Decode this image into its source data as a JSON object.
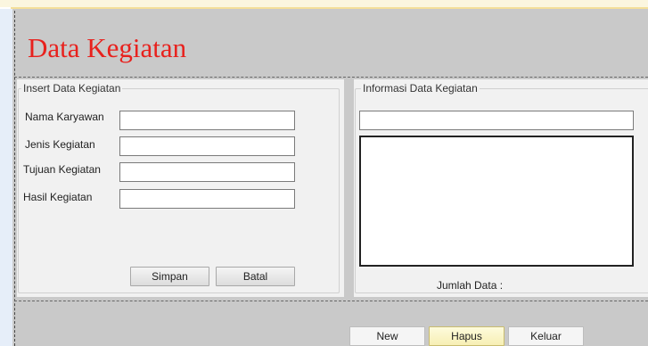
{
  "form": {
    "title": "Data Kegiatan"
  },
  "insert": {
    "legend": "Insert Data Kegiatan",
    "fields": [
      {
        "label": "Nama Karyawan",
        "value": ""
      },
      {
        "label": "Jenis Kegiatan",
        "value": ""
      },
      {
        "label": "Tujuan Kegiatan",
        "value": ""
      },
      {
        "label": "Hasil Kegiatan",
        "value": ""
      }
    ],
    "buttons": {
      "save": "Simpan",
      "cancel": "Batal"
    }
  },
  "info": {
    "legend": "Informasi Data Kegiatan",
    "search_value": "",
    "count_label": "Jumlah Data :"
  },
  "footer": {
    "buttons": {
      "new": "New",
      "delete": "Hapus",
      "exit": "Keluar"
    }
  }
}
